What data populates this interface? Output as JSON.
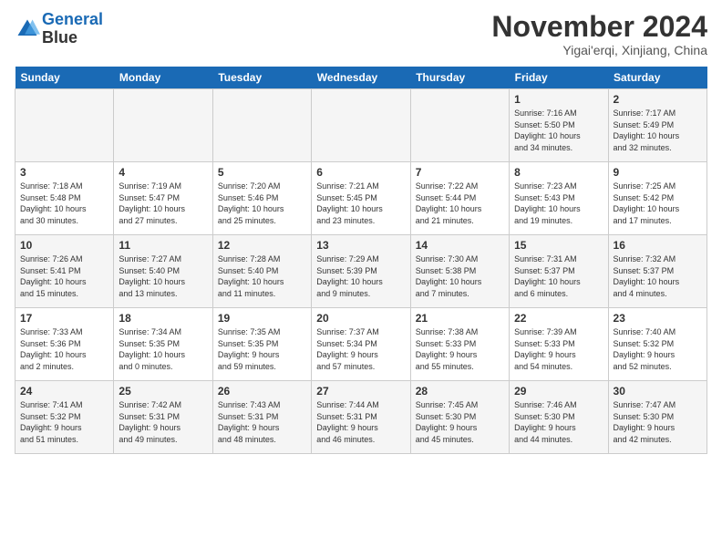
{
  "header": {
    "logo_line1": "General",
    "logo_line2": "Blue",
    "month": "November 2024",
    "location": "Yigai'erqi, Xinjiang, China"
  },
  "weekdays": [
    "Sunday",
    "Monday",
    "Tuesday",
    "Wednesday",
    "Thursday",
    "Friday",
    "Saturday"
  ],
  "weeks": [
    [
      {
        "day": "",
        "info": ""
      },
      {
        "day": "",
        "info": ""
      },
      {
        "day": "",
        "info": ""
      },
      {
        "day": "",
        "info": ""
      },
      {
        "day": "",
        "info": ""
      },
      {
        "day": "1",
        "info": "Sunrise: 7:16 AM\nSunset: 5:50 PM\nDaylight: 10 hours\nand 34 minutes."
      },
      {
        "day": "2",
        "info": "Sunrise: 7:17 AM\nSunset: 5:49 PM\nDaylight: 10 hours\nand 32 minutes."
      }
    ],
    [
      {
        "day": "3",
        "info": "Sunrise: 7:18 AM\nSunset: 5:48 PM\nDaylight: 10 hours\nand 30 minutes."
      },
      {
        "day": "4",
        "info": "Sunrise: 7:19 AM\nSunset: 5:47 PM\nDaylight: 10 hours\nand 27 minutes."
      },
      {
        "day": "5",
        "info": "Sunrise: 7:20 AM\nSunset: 5:46 PM\nDaylight: 10 hours\nand 25 minutes."
      },
      {
        "day": "6",
        "info": "Sunrise: 7:21 AM\nSunset: 5:45 PM\nDaylight: 10 hours\nand 23 minutes."
      },
      {
        "day": "7",
        "info": "Sunrise: 7:22 AM\nSunset: 5:44 PM\nDaylight: 10 hours\nand 21 minutes."
      },
      {
        "day": "8",
        "info": "Sunrise: 7:23 AM\nSunset: 5:43 PM\nDaylight: 10 hours\nand 19 minutes."
      },
      {
        "day": "9",
        "info": "Sunrise: 7:25 AM\nSunset: 5:42 PM\nDaylight: 10 hours\nand 17 minutes."
      }
    ],
    [
      {
        "day": "10",
        "info": "Sunrise: 7:26 AM\nSunset: 5:41 PM\nDaylight: 10 hours\nand 15 minutes."
      },
      {
        "day": "11",
        "info": "Sunrise: 7:27 AM\nSunset: 5:40 PM\nDaylight: 10 hours\nand 13 minutes."
      },
      {
        "day": "12",
        "info": "Sunrise: 7:28 AM\nSunset: 5:40 PM\nDaylight: 10 hours\nand 11 minutes."
      },
      {
        "day": "13",
        "info": "Sunrise: 7:29 AM\nSunset: 5:39 PM\nDaylight: 10 hours\nand 9 minutes."
      },
      {
        "day": "14",
        "info": "Sunrise: 7:30 AM\nSunset: 5:38 PM\nDaylight: 10 hours\nand 7 minutes."
      },
      {
        "day": "15",
        "info": "Sunrise: 7:31 AM\nSunset: 5:37 PM\nDaylight: 10 hours\nand 6 minutes."
      },
      {
        "day": "16",
        "info": "Sunrise: 7:32 AM\nSunset: 5:37 PM\nDaylight: 10 hours\nand 4 minutes."
      }
    ],
    [
      {
        "day": "17",
        "info": "Sunrise: 7:33 AM\nSunset: 5:36 PM\nDaylight: 10 hours\nand 2 minutes."
      },
      {
        "day": "18",
        "info": "Sunrise: 7:34 AM\nSunset: 5:35 PM\nDaylight: 10 hours\nand 0 minutes."
      },
      {
        "day": "19",
        "info": "Sunrise: 7:35 AM\nSunset: 5:35 PM\nDaylight: 9 hours\nand 59 minutes."
      },
      {
        "day": "20",
        "info": "Sunrise: 7:37 AM\nSunset: 5:34 PM\nDaylight: 9 hours\nand 57 minutes."
      },
      {
        "day": "21",
        "info": "Sunrise: 7:38 AM\nSunset: 5:33 PM\nDaylight: 9 hours\nand 55 minutes."
      },
      {
        "day": "22",
        "info": "Sunrise: 7:39 AM\nSunset: 5:33 PM\nDaylight: 9 hours\nand 54 minutes."
      },
      {
        "day": "23",
        "info": "Sunrise: 7:40 AM\nSunset: 5:32 PM\nDaylight: 9 hours\nand 52 minutes."
      }
    ],
    [
      {
        "day": "24",
        "info": "Sunrise: 7:41 AM\nSunset: 5:32 PM\nDaylight: 9 hours\nand 51 minutes."
      },
      {
        "day": "25",
        "info": "Sunrise: 7:42 AM\nSunset: 5:31 PM\nDaylight: 9 hours\nand 49 minutes."
      },
      {
        "day": "26",
        "info": "Sunrise: 7:43 AM\nSunset: 5:31 PM\nDaylight: 9 hours\nand 48 minutes."
      },
      {
        "day": "27",
        "info": "Sunrise: 7:44 AM\nSunset: 5:31 PM\nDaylight: 9 hours\nand 46 minutes."
      },
      {
        "day": "28",
        "info": "Sunrise: 7:45 AM\nSunset: 5:30 PM\nDaylight: 9 hours\nand 45 minutes."
      },
      {
        "day": "29",
        "info": "Sunrise: 7:46 AM\nSunset: 5:30 PM\nDaylight: 9 hours\nand 44 minutes."
      },
      {
        "day": "30",
        "info": "Sunrise: 7:47 AM\nSunset: 5:30 PM\nDaylight: 9 hours\nand 42 minutes."
      }
    ]
  ]
}
